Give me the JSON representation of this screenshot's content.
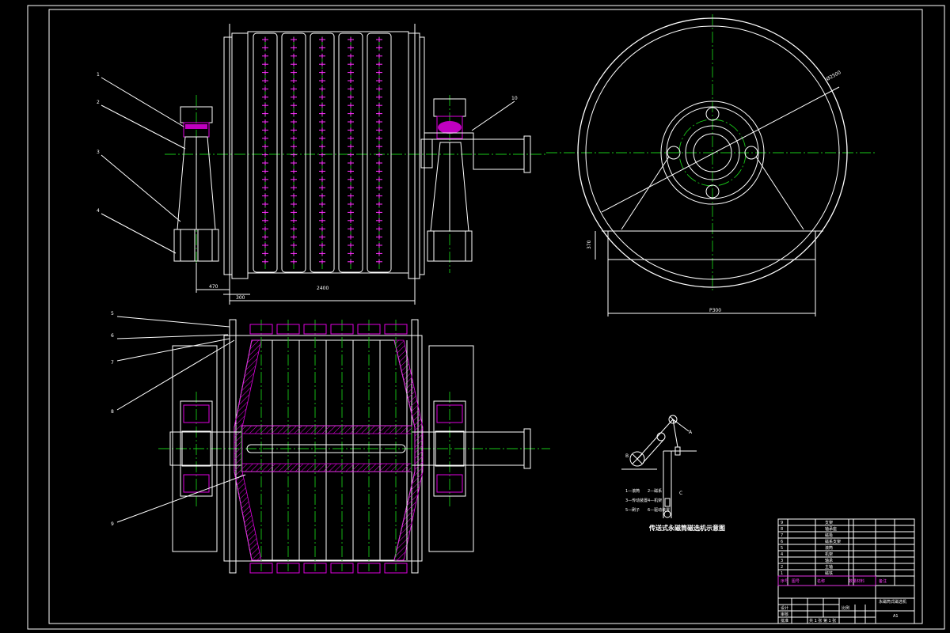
{
  "drawing": {
    "part_labels": [
      "1",
      "2",
      "3",
      "4",
      "5",
      "6",
      "7",
      "8",
      "9",
      "10"
    ],
    "dimensions": {
      "front_left_offset": "470",
      "front_shaft_gap": "300",
      "front_drum_length": "2400",
      "side_diameter": "Ø2500",
      "side_base_width": "P300",
      "side_base_height": "370"
    },
    "schematic": {
      "caption": "传送式永磁筒磁选机示意图",
      "legend": [
        "1—滚筒",
        "2—磁系",
        "3—传动装置",
        "4—机架",
        "5—刷子",
        "6—驱动装置"
      ],
      "points": [
        "A",
        "B",
        "C"
      ]
    },
    "title_block": {
      "bom_rows": [
        {
          "no": "9",
          "name": "支架"
        },
        {
          "no": "8",
          "name": "轴承座"
        },
        {
          "no": "7",
          "name": "磁极"
        },
        {
          "no": "6",
          "name": "磁系支架"
        },
        {
          "no": "5",
          "name": "滚筒"
        },
        {
          "no": "4",
          "name": "机架"
        },
        {
          "no": "3",
          "name": "轴承"
        },
        {
          "no": "2",
          "name": "主轴"
        },
        {
          "no": "1",
          "name": "磁铁"
        }
      ],
      "bom_header": [
        "序号",
        "图号",
        "名称",
        "数量",
        "材料",
        "备注"
      ],
      "drawing_title": "永磁筒式磁选机",
      "sheet": "A1",
      "scale_label": "比例",
      "designer": "设计",
      "checker": "审核",
      "approve": "批准",
      "sheet_text": "共 1 张 第 1 张"
    }
  }
}
